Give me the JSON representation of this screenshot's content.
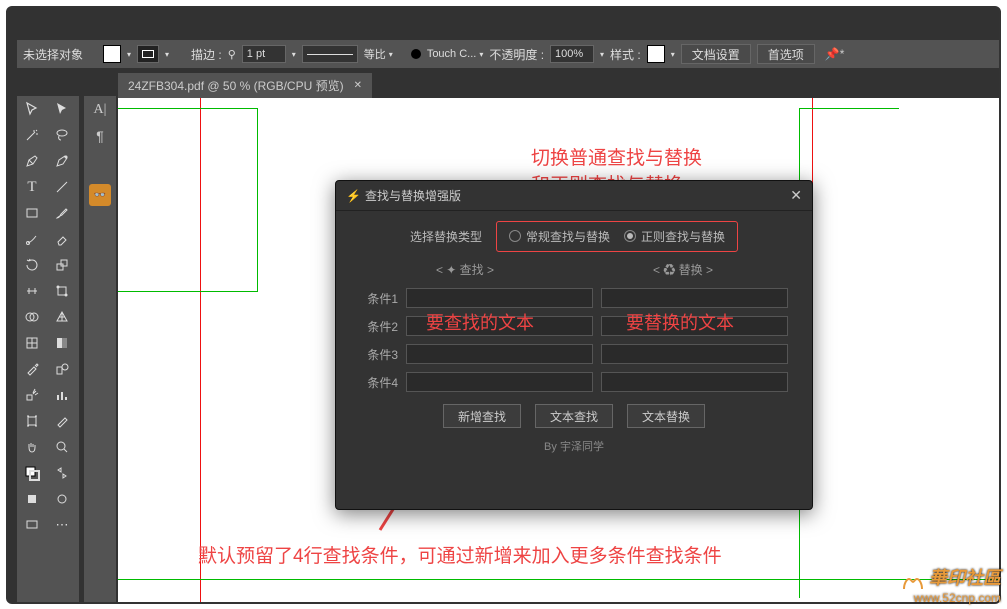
{
  "optbar": {
    "no_selection": "未选择对象",
    "stroke_label": "描边 :",
    "stroke_val": "1 pt",
    "uniform": "等比",
    "profile": "Touch C...",
    "opacity_label": "不透明度 :",
    "opacity_val": "100%",
    "style_label": "样式 :",
    "doc_setup": "文档设置",
    "prefs": "首选项"
  },
  "tab": {
    "title": "24ZFB304.pdf @ 50 % (RGB/CPU 预览)"
  },
  "dialog": {
    "title": "查找与替换增强版",
    "type_label": "选择替换类型",
    "radio_normal": "常规查找与替换",
    "radio_regex": "正则查找与替换",
    "find_head": "< ✦ 查找 >",
    "replace_head": "< ♻ 替换 >",
    "rows": [
      "条件1",
      "条件2",
      "条件3",
      "条件4"
    ],
    "hint_find": "要查找的文本",
    "hint_replace": "要替换的文本",
    "btn_add": "新增查找",
    "btn_find": "文本查找",
    "btn_replace": "文本替换",
    "footer": "By  宇泽同学"
  },
  "anno": {
    "top1": "切换普通查找与替换",
    "top2": "和正则查找与替换",
    "bottom": "默认预留了4行查找条件，可通过新增来加入更多条件查找条件"
  },
  "watermark": {
    "brand": "華印社區",
    "url": "www.52cnp.com"
  }
}
